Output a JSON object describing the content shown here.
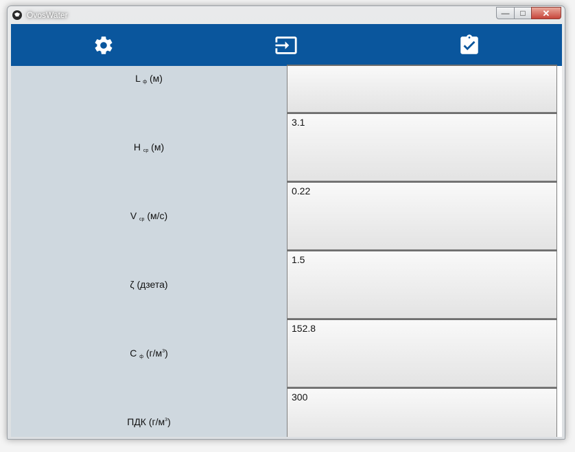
{
  "window": {
    "title": "OvosWater",
    "minimize_glyph": "—",
    "maximize_glyph": "□",
    "close_glyph": "✕"
  },
  "toolbar": {
    "color": "#0a569d",
    "buttons": [
      {
        "icon": "gear-icon"
      },
      {
        "icon": "input-icon"
      },
      {
        "icon": "clipboard-check-icon"
      }
    ]
  },
  "rows": [
    {
      "symbol": "L",
      "sub": "ф",
      "unit": "(м)",
      "sup": "",
      "unit_tail": "",
      "value": ""
    },
    {
      "symbol": "H",
      "sub": "ср",
      "unit": "(м)",
      "sup": "",
      "unit_tail": "",
      "value": "3.1"
    },
    {
      "symbol": "V",
      "sub": "ср",
      "unit": "(м/с)",
      "sup": "",
      "unit_tail": "",
      "value": "0.22"
    },
    {
      "symbol": "ζ",
      "sub": "",
      "unit": "(дзета)",
      "sup": "",
      "unit_tail": "",
      "value": "1.5"
    },
    {
      "symbol": "C",
      "sub": "ф",
      "unit": "(г/м",
      "sup": "3",
      "unit_tail": ")",
      "value": "152.8"
    },
    {
      "symbol": "ПДК",
      "sub": "",
      "unit": "(г/м",
      "sup": "3",
      "unit_tail": ")",
      "value": "300"
    }
  ]
}
